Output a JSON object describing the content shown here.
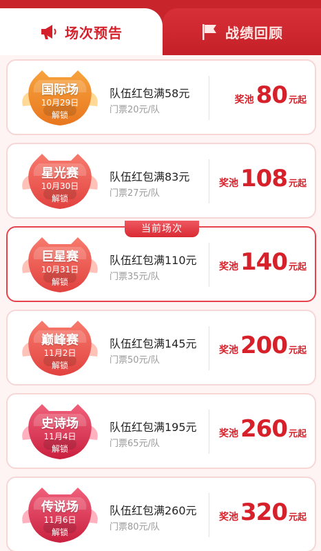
{
  "tabs": [
    {
      "label": "场次预告",
      "icon": "megaphone-icon",
      "active": true
    },
    {
      "label": "战绩回顾",
      "icon": "flag-icon",
      "active": false
    }
  ],
  "current_tag": "当前场次",
  "colors": {
    "brand_red": "#d4202a",
    "badge_orange": "#f08a2c",
    "badge_red": "#ef5a52",
    "badge_rose": "#e33f5d"
  },
  "matches": [
    {
      "name": "国际场",
      "date": "10月29日",
      "status": "解锁",
      "title": "队伍红包满58元",
      "ticket": "门票20元/队",
      "prize_label": "奖池",
      "prize_amount": "80",
      "prize_unit": "元起",
      "current": false,
      "badge_color": "orange"
    },
    {
      "name": "星光赛",
      "date": "10月30日",
      "status": "解锁",
      "title": "队伍红包满83元",
      "ticket": "门票27元/队",
      "prize_label": "奖池",
      "prize_amount": "108",
      "prize_unit": "元起",
      "current": false,
      "badge_color": "red"
    },
    {
      "name": "巨星赛",
      "date": "10月31日",
      "status": "解锁",
      "title": "队伍红包满110元",
      "ticket": "门票35元/队",
      "prize_label": "奖池",
      "prize_amount": "140",
      "prize_unit": "元起",
      "current": true,
      "badge_color": "red"
    },
    {
      "name": "巅峰赛",
      "date": "11月2日",
      "status": "解锁",
      "title": "队伍红包满145元",
      "ticket": "门票50元/队",
      "prize_label": "奖池",
      "prize_amount": "200",
      "prize_unit": "元起",
      "current": false,
      "badge_color": "red"
    },
    {
      "name": "史诗场",
      "date": "11月4日",
      "status": "解锁",
      "title": "队伍红包满195元",
      "ticket": "门票65元/队",
      "prize_label": "奖池",
      "prize_amount": "260",
      "prize_unit": "元起",
      "current": false,
      "badge_color": "rose"
    },
    {
      "name": "传说场",
      "date": "11月6日",
      "status": "解锁",
      "title": "队伍红包满260元",
      "ticket": "门票80元/队",
      "prize_label": "奖池",
      "prize_amount": "320",
      "prize_unit": "元起",
      "current": false,
      "badge_color": "rose"
    }
  ]
}
